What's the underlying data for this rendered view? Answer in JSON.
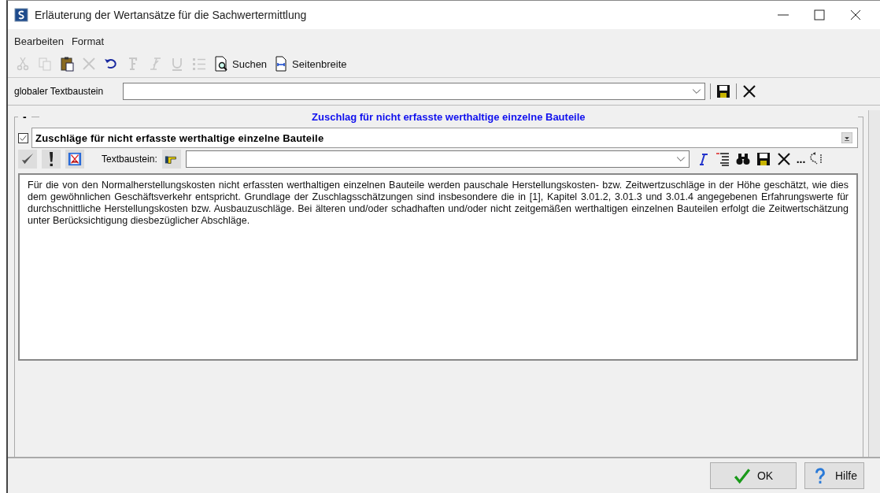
{
  "window": {
    "title": "Erläuterung der Wertansätze für die Sachwertermittlung"
  },
  "menu": [
    {
      "label": "Bearbeiten"
    },
    {
      "label": "Format"
    }
  ],
  "toolbar": [
    {
      "kind": "cut",
      "disabled": true
    },
    {
      "kind": "copy",
      "disabled": true
    },
    {
      "kind": "paste",
      "disabled": false
    },
    {
      "kind": "delete",
      "disabled": true
    },
    {
      "kind": "undo",
      "disabled": false
    },
    {
      "kind": "bold",
      "disabled": true
    },
    {
      "kind": "italic",
      "disabled": true
    },
    {
      "kind": "underline",
      "disabled": true
    },
    {
      "kind": "list",
      "disabled": true
    },
    {
      "kind": "search",
      "label": "Suchen",
      "disabled": false
    },
    {
      "kind": "pagewidth",
      "label": "Seitenbreite",
      "disabled": false
    }
  ],
  "global_text_block": {
    "label": "globaler Textbaustein"
  },
  "section": {
    "collapse_symbol": "-",
    "heading": "Zuschlag für nicht erfasste werthaltige einzelne Bauteile",
    "item": {
      "checked": true,
      "title": "Zuschläge für nicht erfasste werthaltige einzelne Bauteile"
    },
    "text_block_label": "Textbaustein:",
    "more": "...",
    "body": "Für die von den Normalherstellungskosten nicht erfassten werthaltigen einzelnen Bauteile werden pauschale Herstellungskosten- bzw. Zeitwertzuschläge in der Höhe geschätzt, wie dies dem gewöhnlichen Geschäftsverkehr entspricht. Grundlage der Zuschlagsschätzungen sind insbesondere die in [1], Kapitel 3.01.2, 3.01.3 und 3.01.4 angegebenen Erfahrungswerte für durchschnittliche Herstellungskosten bzw. Ausbauzuschläge. Bei älteren und/oder schadhaften und/oder nicht zeitgemäßen werthaltigen einzelnen Bauteilen erfolgt die Zeitwertschätzung unter Berücksichtigung diesbezüglicher Abschläge."
  },
  "buttons": [
    {
      "kind": "ok",
      "label": "OK"
    },
    {
      "kind": "help",
      "label": "Hilfe"
    }
  ]
}
